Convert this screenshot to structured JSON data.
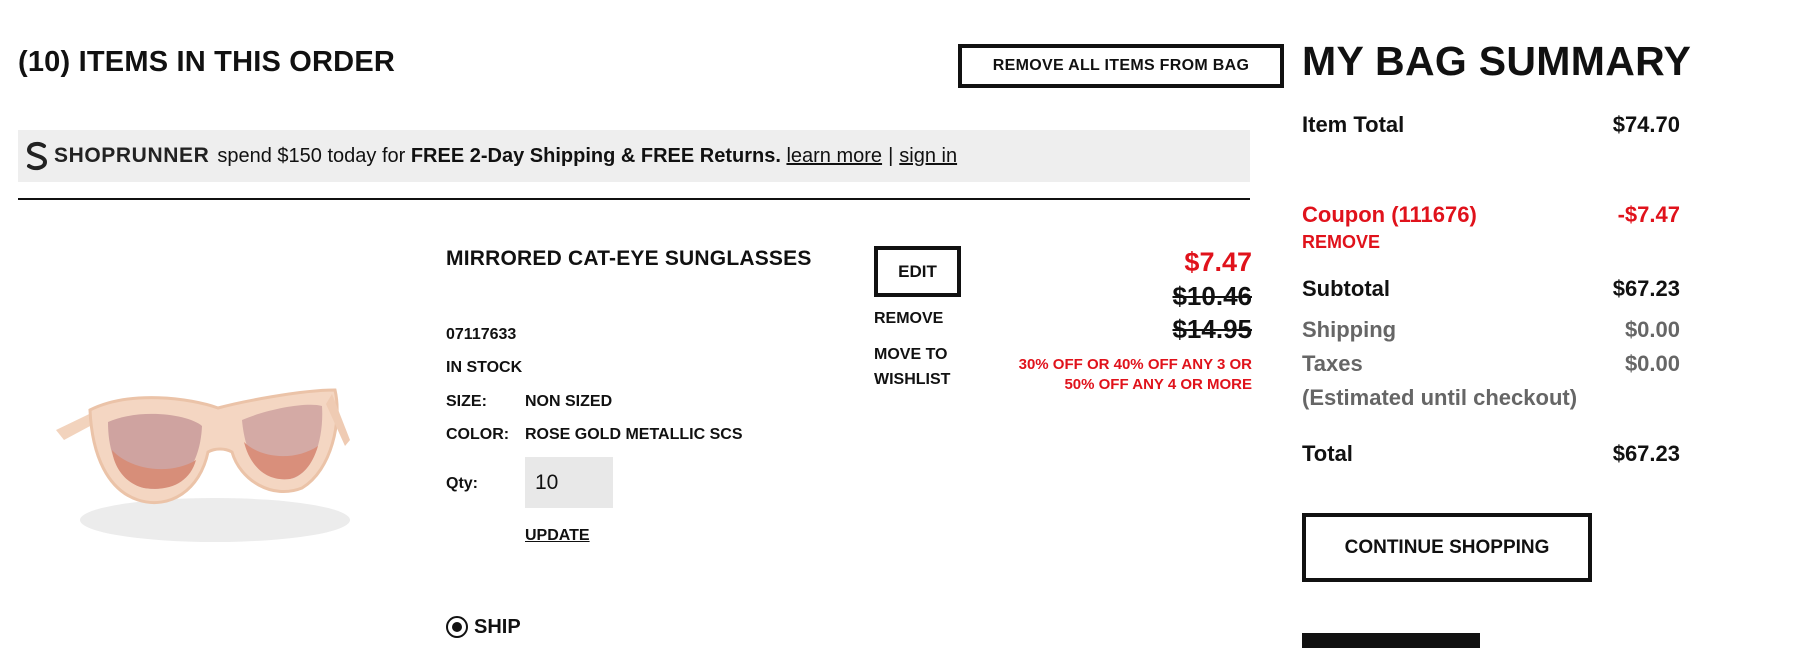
{
  "order": {
    "heading": "(10) ITEMS IN THIS ORDER",
    "remove_all_label": "REMOVE ALL ITEMS FROM BAG"
  },
  "shoprunner": {
    "logo_text": "SHOPRUNNER",
    "pre_text": "spend $150 today for",
    "bold_text": "FREE 2-Day Shipping & FREE Returns.",
    "learn_more": "learn more",
    "separator": "|",
    "sign_in": "sign in"
  },
  "item": {
    "name": "MIRRORED CAT-EYE SUNGLASSES",
    "sku": "07117633",
    "stock": "IN STOCK",
    "size_label": "SIZE:",
    "size_value": "NON SIZED",
    "color_label": "COLOR:",
    "color_value": "ROSE GOLD METALLIC SCS",
    "qty_label": "Qty:",
    "qty_value": "10",
    "update_label": "UPDATE",
    "ship_label": "SHIP",
    "edit_label": "EDIT",
    "remove_label": "REMOVE",
    "move_to_wishlist_label": "MOVE TO WISHLIST",
    "price_sale": "$7.47",
    "price_was_1": "$10.46",
    "price_was_2": "$14.95",
    "promo_text": "30% OFF OR 40% OFF ANY 3 OR 50% OFF ANY 4 OR MORE"
  },
  "summary": {
    "title": "MY BAG SUMMARY",
    "item_total_label": "Item Total",
    "item_total_value": "$74.70",
    "coupon_label": "Coupon (111676)",
    "coupon_value": "-$7.47",
    "coupon_remove": "REMOVE",
    "subtotal_label": "Subtotal",
    "subtotal_value": "$67.23",
    "shipping_label": "Shipping",
    "shipping_value": "$0.00",
    "taxes_label": "Taxes",
    "taxes_value": "$0.00",
    "estimated_note": "(Estimated until checkout)",
    "total_label": "Total",
    "total_value": "$67.23",
    "continue_label": "CONTINUE SHOPPING"
  },
  "colors": {
    "accent_red": "#e0121b",
    "bar_grey": "#eeeeee",
    "muted_grey": "#666666"
  },
  "icons": {
    "shoprunner_logo": "shoprunner-s-icon",
    "radio": "radio-selected-icon"
  }
}
